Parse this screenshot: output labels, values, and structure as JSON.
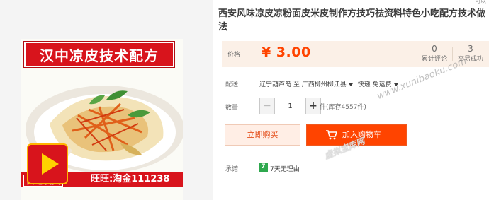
{
  "gallery": {
    "banner_title": "汉中凉皮技术配方",
    "auto_ship_label": "自动发货",
    "wangwang_text": "旺旺:淘金111238"
  },
  "product": {
    "title": "西安风味凉皮凉粉面皮米皮制作方技巧祛资料特色小吃配方技术做法",
    "top_hint": "可以"
  },
  "price": {
    "label": "价格",
    "value": "¥ 3.00",
    "reviews_count": "0",
    "reviews_label": "累计评论",
    "sales_count": "3",
    "sales_label": "交易成功"
  },
  "shipping": {
    "label": "配送",
    "from": "辽宁葫芦岛",
    "to_word": "至",
    "destination": "广西柳州柳江县",
    "express": "快递",
    "fee": "免运费"
  },
  "quantity": {
    "label": "数量",
    "minus": "−",
    "value": "1",
    "plus": "+",
    "stock_text": "件(库存4557件)"
  },
  "actions": {
    "buy_now": "立即购买",
    "add_to_cart": "加入购物车"
  },
  "promise": {
    "label": "承诺",
    "badge": "7",
    "text": "7天无理由"
  },
  "watermark": {
    "url": "www.xunibaoku.com",
    "cn": "虚拟宝库网"
  },
  "colors": {
    "price_orange": "#ff4400",
    "banner_red": "#d8141c",
    "promise_green": "#2fa84e"
  }
}
